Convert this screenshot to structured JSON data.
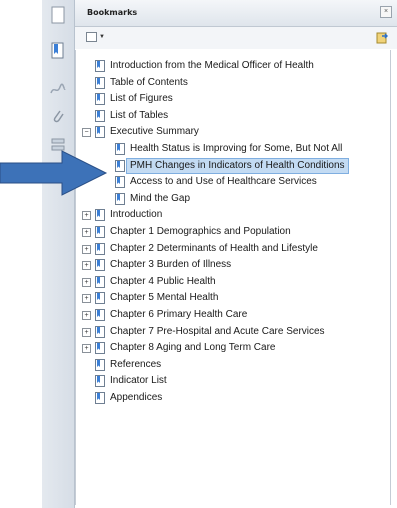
{
  "panel": {
    "title": "Bookmarks",
    "close_label": "×"
  },
  "bookmarks": [
    {
      "label": "Introduction from the Medical Officer of Health",
      "level": 1,
      "expander": ""
    },
    {
      "label": "Table of Contents",
      "level": 1,
      "expander": ""
    },
    {
      "label": "List of Figures",
      "level": 1,
      "expander": ""
    },
    {
      "label": "List of Tables",
      "level": 1,
      "expander": ""
    },
    {
      "label": "Executive Summary",
      "level": 1,
      "expander": "−"
    },
    {
      "label": "Health Status is Improving for Some, But Not All",
      "level": 2,
      "expander": ""
    },
    {
      "label": "PMH Changes in Indicators of Health Conditions",
      "level": 2,
      "expander": "",
      "selected": true
    },
    {
      "label": "Access to and Use of Healthcare Services",
      "level": 2,
      "expander": ""
    },
    {
      "label": "Mind the Gap",
      "level": 2,
      "expander": ""
    },
    {
      "label": "Introduction",
      "level": 1,
      "expander": "+"
    },
    {
      "label": "Chapter 1 Demographics and Population",
      "level": 1,
      "expander": "+"
    },
    {
      "label": "Chapter 2 Determinants of Health and Lifestyle",
      "level": 1,
      "expander": "+"
    },
    {
      "label": "Chapter 3 Burden of Illness",
      "level": 1,
      "expander": "+"
    },
    {
      "label": "Chapter 4 Public Health",
      "level": 1,
      "expander": "+"
    },
    {
      "label": "Chapter 5 Mental Health",
      "level": 1,
      "expander": "+"
    },
    {
      "label": "Chapter 6 Primary Health Care",
      "level": 1,
      "expander": "+"
    },
    {
      "label": "Chapter 7 Pre-Hospital and Acute Care Services",
      "level": 1,
      "expander": "+"
    },
    {
      "label": "Chapter 8 Aging and Long Term Care",
      "level": 1,
      "expander": "+"
    },
    {
      "label": "References",
      "level": 1,
      "expander": ""
    },
    {
      "label": "Indicator List",
      "level": 1,
      "expander": ""
    },
    {
      "label": "Appendices",
      "level": 1,
      "expander": ""
    }
  ],
  "colors": {
    "selection": "#c3dbf3",
    "arrow": "#3d72b8"
  }
}
